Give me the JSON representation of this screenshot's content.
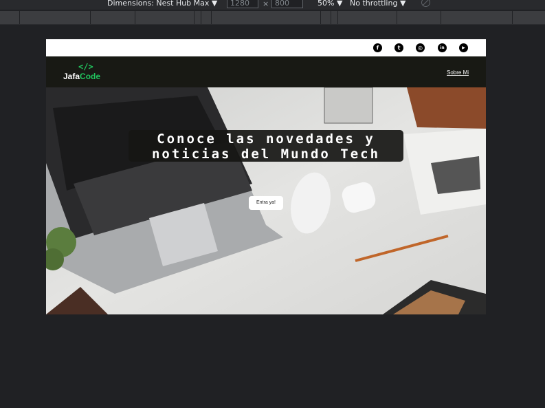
{
  "devtools": {
    "dimensions_label": "Dimensions: Nest Hub Max ▼",
    "width_value": "1280",
    "height_value": "800",
    "times": "×",
    "zoom": "50% ▼",
    "throttling": "No throttling ▼"
  },
  "site": {
    "logo_mark": "</>",
    "logo_word_white": "Jafa",
    "logo_word_green": "Code",
    "nav_link": "Sobre Mi",
    "hero_title": "Conoce las novedades y noticias del Mundo Tech",
    "cta_label": "Entra ya!"
  },
  "social": [
    {
      "icon": "facebook-icon",
      "glyph": "f"
    },
    {
      "icon": "tumblr-icon",
      "glyph": "t"
    },
    {
      "icon": "instagram-icon",
      "glyph": "◎"
    },
    {
      "icon": "linkedin-icon",
      "glyph": "in"
    },
    {
      "icon": "youtube-icon",
      "glyph": "▶"
    }
  ],
  "colors": {
    "brand_green": "#21c35d",
    "navbar_bg": "#181914",
    "devtools_bg": "#202124"
  }
}
